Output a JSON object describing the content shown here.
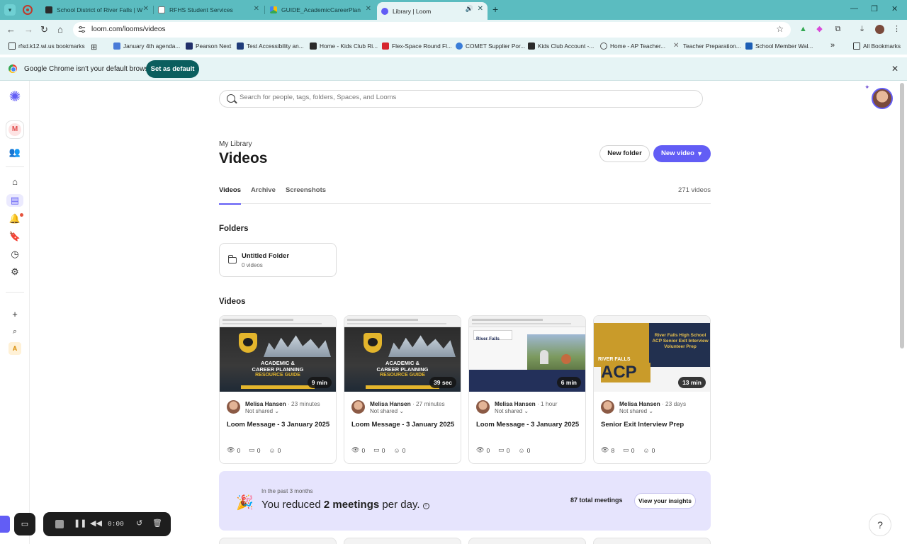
{
  "browser": {
    "tabs": [
      {
        "title": "School District of River Falls | W",
        "favicon_color": "#2b2b2b"
      },
      {
        "title": "RFHS Student Services",
        "favicon_color": "#ffffff"
      },
      {
        "title": "GUIDE_AcademicCareerPlannin",
        "favicon_color": "#fbbc05"
      },
      {
        "title": "Library | Loom",
        "favicon_color": "#625df5"
      }
    ],
    "new_tab": "+",
    "url": "loom.com/looms/videos",
    "bookmarks": [
      {
        "label": "rfsd.k12.wi.us bookmarks",
        "color": "#3a3a3a"
      },
      {
        "label": "January 4th agenda...",
        "color": "#4a7bd8"
      },
      {
        "label": "Pearson Next",
        "color": "#22306a"
      },
      {
        "label": "Test Accessibility an...",
        "color": "#1f3c7a"
      },
      {
        "label": "Home - Kids Club Ri...",
        "color": "#2b2b2b"
      },
      {
        "label": "Flex-Space Round Fl...",
        "color": "#d6262e"
      },
      {
        "label": "COMET Supplier Por...",
        "color": "#3a7dd8"
      },
      {
        "label": "Kids Club Account -...",
        "color": "#2b2b2b"
      },
      {
        "label": "Home - AP Teacher...",
        "color": "#555555"
      },
      {
        "label": "Teacher Preparation...",
        "color": "#6b6b6b"
      },
      {
        "label": "School Member Wal...",
        "color": "#1d5fb5"
      }
    ],
    "bookmarks_more": "»",
    "all_bookmarks": "All Bookmarks",
    "infobar": {
      "message": "Google Chrome isn't your default browser",
      "button": "Set as default"
    }
  },
  "sidebar": {
    "workspace_initial": "M",
    "bottom_initial": "A"
  },
  "search": {
    "placeholder": "Search for people, tags, folders, Spaces, and Looms"
  },
  "header": {
    "breadcrumb": "My Library",
    "title": "Videos",
    "new_folder": "New folder",
    "new_video": "New video"
  },
  "tabs": {
    "items": [
      "Videos",
      "Archive",
      "Screenshots"
    ],
    "count": "271 videos"
  },
  "folders": {
    "heading": "Folders",
    "items": [
      {
        "name": "Untitled Folder",
        "count": "0 videos"
      }
    ]
  },
  "videos": {
    "heading": "Videos",
    "items": [
      {
        "duration": "9 min",
        "author": "Melisa Hansen",
        "ago": "· 23 minutes",
        "share": "Not shared",
        "title": "Loom Message - 3 January 2025",
        "views": "0",
        "comments": "0",
        "reactions": "0",
        "thumb_line1": "ACADEMIC &",
        "thumb_line2": "CAREER PLANNING",
        "thumb_line3": "RESOURCE GUIDE"
      },
      {
        "duration": "39 sec",
        "author": "Melisa Hansen",
        "ago": "· 27 minutes",
        "share": "Not shared",
        "title": "Loom Message - 3 January 2025",
        "views": "0",
        "comments": "0",
        "reactions": "0",
        "thumb_line1": "ACADEMIC &",
        "thumb_line2": "CAREER PLANNING",
        "thumb_line3": "RESOURCE GUIDE"
      },
      {
        "duration": "6 min",
        "author": "Melisa Hansen",
        "ago": "· 1 hour",
        "share": "Not shared",
        "title": "Loom Message - 3 January 2025",
        "views": "0",
        "comments": "0",
        "reactions": "0",
        "thumb_school": "River Falls"
      },
      {
        "duration": "13 min",
        "author": "Melisa Hansen",
        "ago": "· 23 days",
        "share": "Not shared",
        "title": "Senior Exit Interview Prep",
        "views": "8",
        "comments": "0",
        "reactions": "0",
        "thumb_text": "River Falls High School ACP Senior Exit Interview Volunteer Prep",
        "thumb_strip": "RIVER FALLS",
        "thumb_acp": "ACP"
      }
    ]
  },
  "insights": {
    "period": "In the past 3 months",
    "text_prefix": "You reduced",
    "text_bold": "2 meetings",
    "text_suffix": "per day.",
    "total": "87 total meetings",
    "button": "View your insights"
  },
  "recorder": {
    "time": "0:00"
  },
  "help": "?"
}
